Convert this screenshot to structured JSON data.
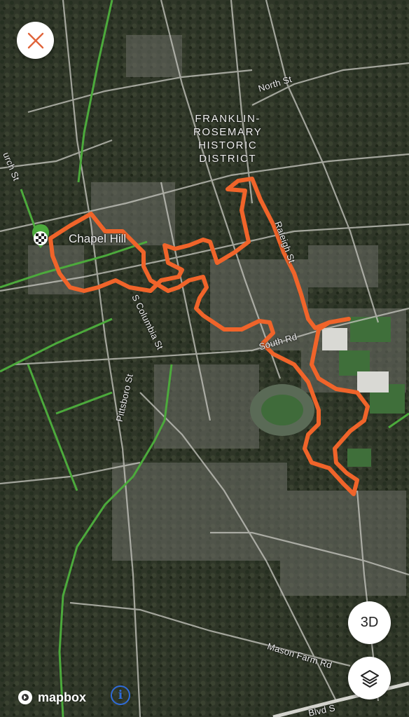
{
  "colors": {
    "route": "#f0642a",
    "greenway": "#4caa3c",
    "road": "#c9c9c2",
    "close_icon": "#e0643a",
    "info_icon": "#2f6bd8"
  },
  "labels": {
    "district": [
      "FRANKLIN-",
      "ROSEMARY",
      "HISTORIC",
      "DISTRICT"
    ],
    "city": "Chapel Hill",
    "north_st": "North St",
    "raleigh_st": "Raleigh St",
    "south_rd": "South Rd",
    "s_columbia_st": "S Columbia St",
    "pittsboro_st": "Pittsboro St",
    "church_st": "urch St",
    "mason_farm_rd": "Mason Farm Rd",
    "bottom_road": "Blvd S"
  },
  "controls": {
    "close_icon": "close-icon",
    "btn_3d": "3D",
    "layers_icon": "layers-icon",
    "mapbox": "mapbox",
    "info": "i"
  },
  "start_finish_icon": "checkered-flag-icon"
}
